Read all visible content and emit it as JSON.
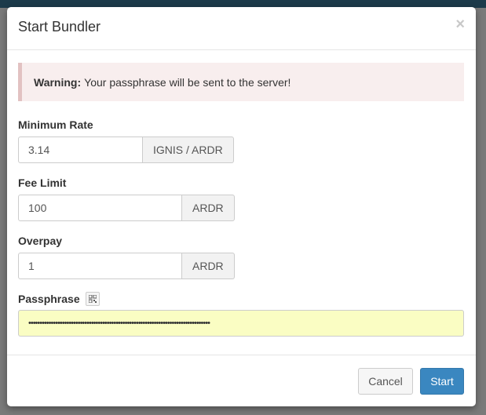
{
  "dialog": {
    "title": "Start Bundler"
  },
  "alert": {
    "strong": "Warning:",
    "message": "Your passphrase will be sent to the server!"
  },
  "fields": {
    "min_rate": {
      "label": "Minimum Rate",
      "value": "3.14",
      "unit": "IGNIS / ARDR"
    },
    "fee_limit": {
      "label": "Fee Limit",
      "value": "100",
      "unit": "ARDR"
    },
    "overpay": {
      "label": "Overpay",
      "value": "1",
      "unit": "ARDR"
    },
    "passphrase": {
      "label": "Passphrase",
      "value": "•••••••••••••••••••••••••••••••••••••••••••••••••••••••••••••••••••••••••••••••••"
    }
  },
  "buttons": {
    "cancel": "Cancel",
    "start": "Start"
  },
  "colors": {
    "alert_bg": "#f8eeee",
    "passphrase_bg": "#fafdc3",
    "primary": "#3a87c0"
  },
  "icons": {
    "close": "close-icon",
    "qr": "qr-code-icon"
  }
}
